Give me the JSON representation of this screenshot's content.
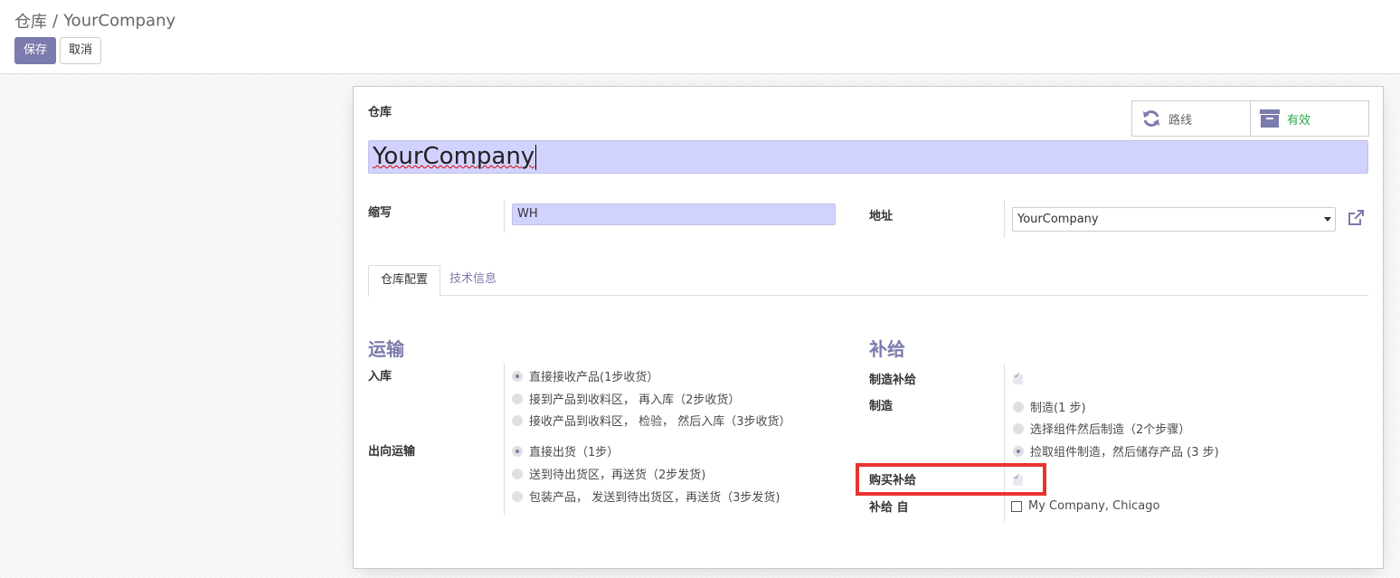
{
  "breadcrumb": {
    "parent": "仓库",
    "separator": "/",
    "current": "YourCompany"
  },
  "toolbar": {
    "save_label": "保存",
    "cancel_label": "取消"
  },
  "form": {
    "name_label": "仓库",
    "name_value": "YourCompany",
    "smart_buttons": {
      "routes_label": "路线",
      "active_label": "有效"
    },
    "code_label": "缩写",
    "code_value": "WH",
    "address_label": "地址",
    "address_value": "YourCompany"
  },
  "tabs": [
    {
      "label": "仓库配置",
      "active": true
    },
    {
      "label": "技术信息",
      "active": false
    }
  ],
  "shipments": {
    "title": "运输",
    "incoming_label": "入库",
    "incoming_options": [
      {
        "label": "直接接收产品(1步收货）",
        "checked": true
      },
      {
        "label": "接到产品到收料区， 再入库（2步收货）",
        "checked": false
      },
      {
        "label": "接收产品到收料区， 检验， 然后入库（3步收货）",
        "checked": false
      }
    ],
    "outgoing_label": "出向运输",
    "outgoing_options": [
      {
        "label": "直接出货（1步）",
        "checked": true
      },
      {
        "label": "送到待出货区，再送货（2步发货)",
        "checked": false
      },
      {
        "label": "包装产品， 发送到待出货区，再送货（3步发货)",
        "checked": false
      }
    ]
  },
  "resupply": {
    "title": "补给",
    "manufacture_resupply_label": "制造补给",
    "manufacture_resupply_checked": true,
    "manufacture_label": "制造",
    "manufacture_options": [
      {
        "label": "制造(1 步)",
        "checked": false
      },
      {
        "label": "选择组件然后制造（2个步骤）",
        "checked": false
      },
      {
        "label": "捡取组件制造，然后储存产品 (3 步)",
        "checked": true
      }
    ],
    "buy_resupply_label": "购买补给",
    "buy_resupply_checked": true,
    "resupply_from_label": "补给 自",
    "resupply_from_option": "My Company, Chicago",
    "resupply_from_checked": false
  },
  "colors": {
    "primary": "#7c7bad",
    "active": "#28a745",
    "highlight": "#e8342f",
    "input_bg": "#d2d2ff"
  }
}
